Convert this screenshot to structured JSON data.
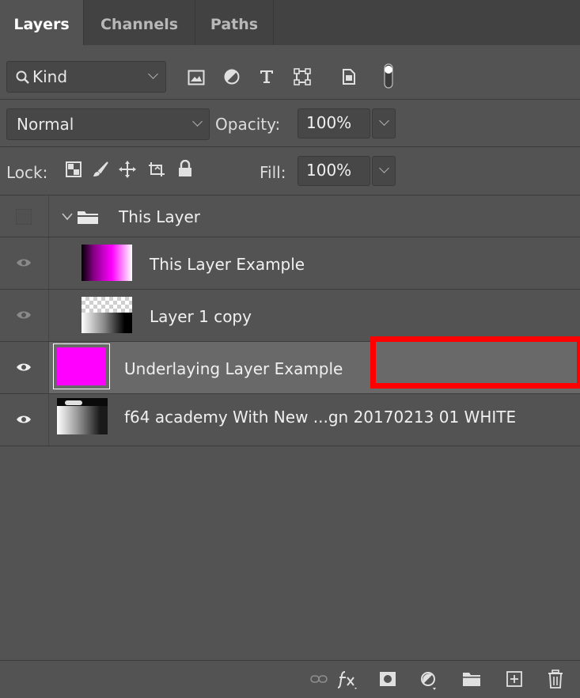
{
  "tabs": [
    {
      "label": "Layers"
    },
    {
      "label": "Channels"
    },
    {
      "label": "Paths"
    }
  ],
  "filter": {
    "kind_label": "Kind"
  },
  "blend": {
    "mode": "Normal",
    "opacity_label": "Opacity:",
    "opacity_value": "100%"
  },
  "lock": {
    "lock_label": "Lock:",
    "fill_label": "Fill:",
    "fill_value": "100%"
  },
  "layers": [
    {
      "name": "This Layer",
      "type": "group",
      "visible": false
    },
    {
      "name": "This Layer Example",
      "type": "gradient-magenta",
      "visible": true
    },
    {
      "name": "Layer 1 copy",
      "type": "transparent-gradient",
      "visible": true
    },
    {
      "name": "Underlaying Layer Example",
      "type": "solid-magenta",
      "visible": true,
      "selected": true
    },
    {
      "name": "f64 academy With New ...gn 20170213 01 WHITE",
      "type": "photo",
      "visible": true
    }
  ],
  "colors": {
    "panel_bg": "#535353",
    "tabbar_bg": "#424242",
    "selected_row": "#696969",
    "magenta": "#ff00ff",
    "highlight": "#ff0000"
  }
}
